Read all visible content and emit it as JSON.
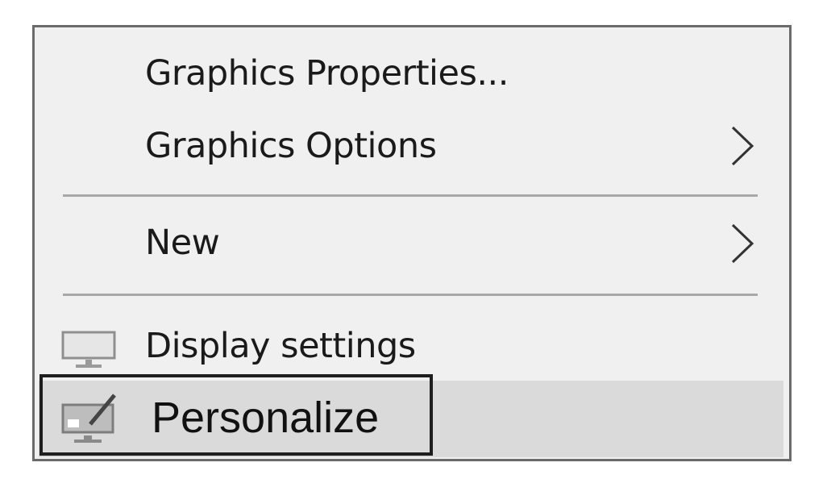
{
  "context_menu": {
    "items": [
      {
        "label": "Graphics Properties...",
        "has_submenu": false
      },
      {
        "label": "Graphics Options",
        "has_submenu": true
      },
      {
        "label": "New",
        "has_submenu": true
      },
      {
        "label": "Display settings",
        "icon": "display-icon",
        "has_submenu": false
      },
      {
        "label": "Personalize",
        "icon": "personalize-icon",
        "has_submenu": false,
        "highlighted": true
      }
    ]
  },
  "colors": {
    "menu_background": "#f0f0f0",
    "highlight_background": "#dadada",
    "separator": "#a8a8a8",
    "border": "#6b6b6b"
  }
}
